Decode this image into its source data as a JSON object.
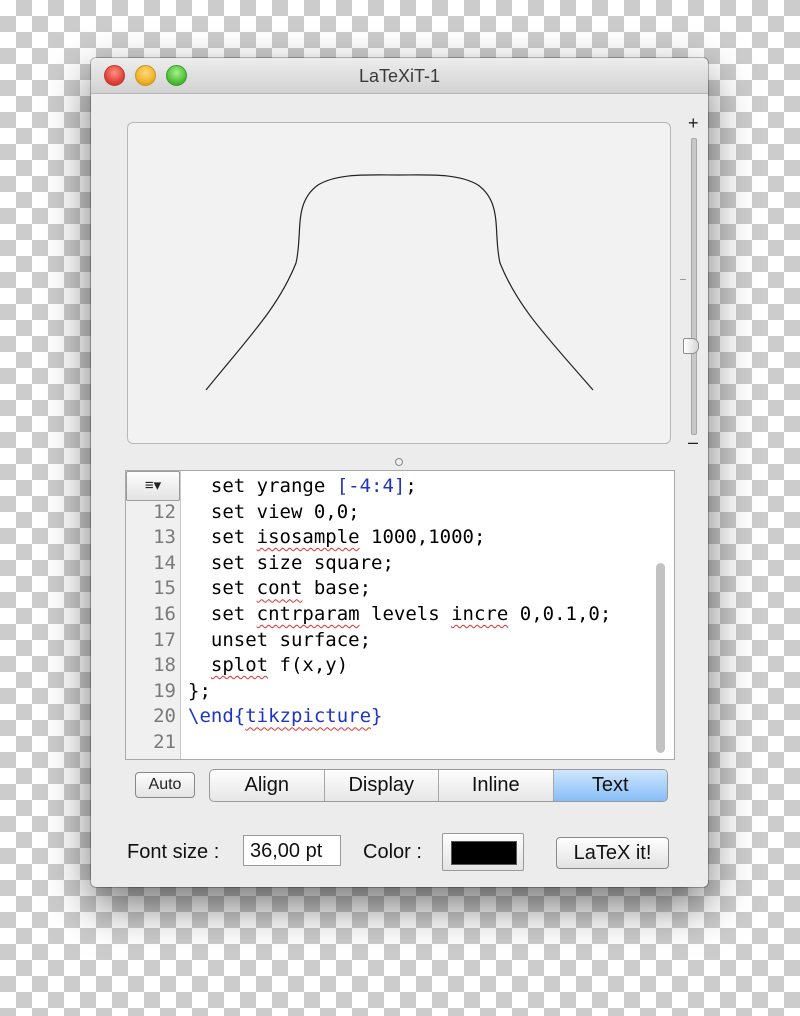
{
  "window": {
    "title": "LaTeXiT-1"
  },
  "zoom": {
    "plus": "+",
    "minus": "–"
  },
  "editor": {
    "menu_glyph": "≡▾",
    "lines": [
      {
        "num": "",
        "parts": [
          {
            "t": "  set yrange ",
            "c": ""
          },
          {
            "t": "[-4:4]",
            "c": "kw-blue"
          },
          {
            "t": ";",
            "c": ""
          }
        ]
      },
      {
        "num": "12",
        "parts": [
          {
            "t": "  set view 0,0;",
            "c": ""
          }
        ]
      },
      {
        "num": "13",
        "parts": [
          {
            "t": "  set ",
            "c": ""
          },
          {
            "t": "isosample",
            "c": "spell"
          },
          {
            "t": " 1000,1000;",
            "c": ""
          }
        ]
      },
      {
        "num": "14",
        "parts": [
          {
            "t": "  set size square;",
            "c": ""
          }
        ]
      },
      {
        "num": "15",
        "parts": [
          {
            "t": "  set ",
            "c": ""
          },
          {
            "t": "cont",
            "c": "spell"
          },
          {
            "t": " base;",
            "c": ""
          }
        ]
      },
      {
        "num": "16",
        "parts": [
          {
            "t": "  set ",
            "c": ""
          },
          {
            "t": "cntrparam",
            "c": "spell"
          },
          {
            "t": " levels ",
            "c": ""
          },
          {
            "t": "incre",
            "c": "spell"
          },
          {
            "t": " 0,0.1,0;",
            "c": ""
          }
        ]
      },
      {
        "num": "17",
        "parts": [
          {
            "t": "  unset surface;",
            "c": ""
          }
        ]
      },
      {
        "num": "18",
        "parts": [
          {
            "t": "  ",
            "c": ""
          },
          {
            "t": "splot",
            "c": "spell"
          },
          {
            "t": " f(x,y)",
            "c": ""
          }
        ]
      },
      {
        "num": "19",
        "parts": [
          {
            "t": "};",
            "c": ""
          }
        ]
      },
      {
        "num": "20",
        "parts": [
          {
            "t": "\\end{",
            "c": "kw-blue"
          },
          {
            "t": "tikzpicture",
            "c": "kw-blue spell"
          },
          {
            "t": "}",
            "c": "kw-blue"
          }
        ]
      },
      {
        "num": "21",
        "parts": [
          {
            "t": "",
            "c": ""
          }
        ]
      }
    ]
  },
  "auto_button": "Auto",
  "modes": [
    {
      "label": "Align",
      "active": false
    },
    {
      "label": "Display",
      "active": false
    },
    {
      "label": "Inline",
      "active": false
    },
    {
      "label": "Text",
      "active": true
    }
  ],
  "font_size": {
    "label": "Font size :",
    "value": "36,00 pt"
  },
  "color": {
    "label": "Color :",
    "value": "#000000"
  },
  "latex_button": "LaTeX it!",
  "colors": {
    "accent": "#86bdf6",
    "keyword": "#1f34c4",
    "spell": "#e03030"
  }
}
